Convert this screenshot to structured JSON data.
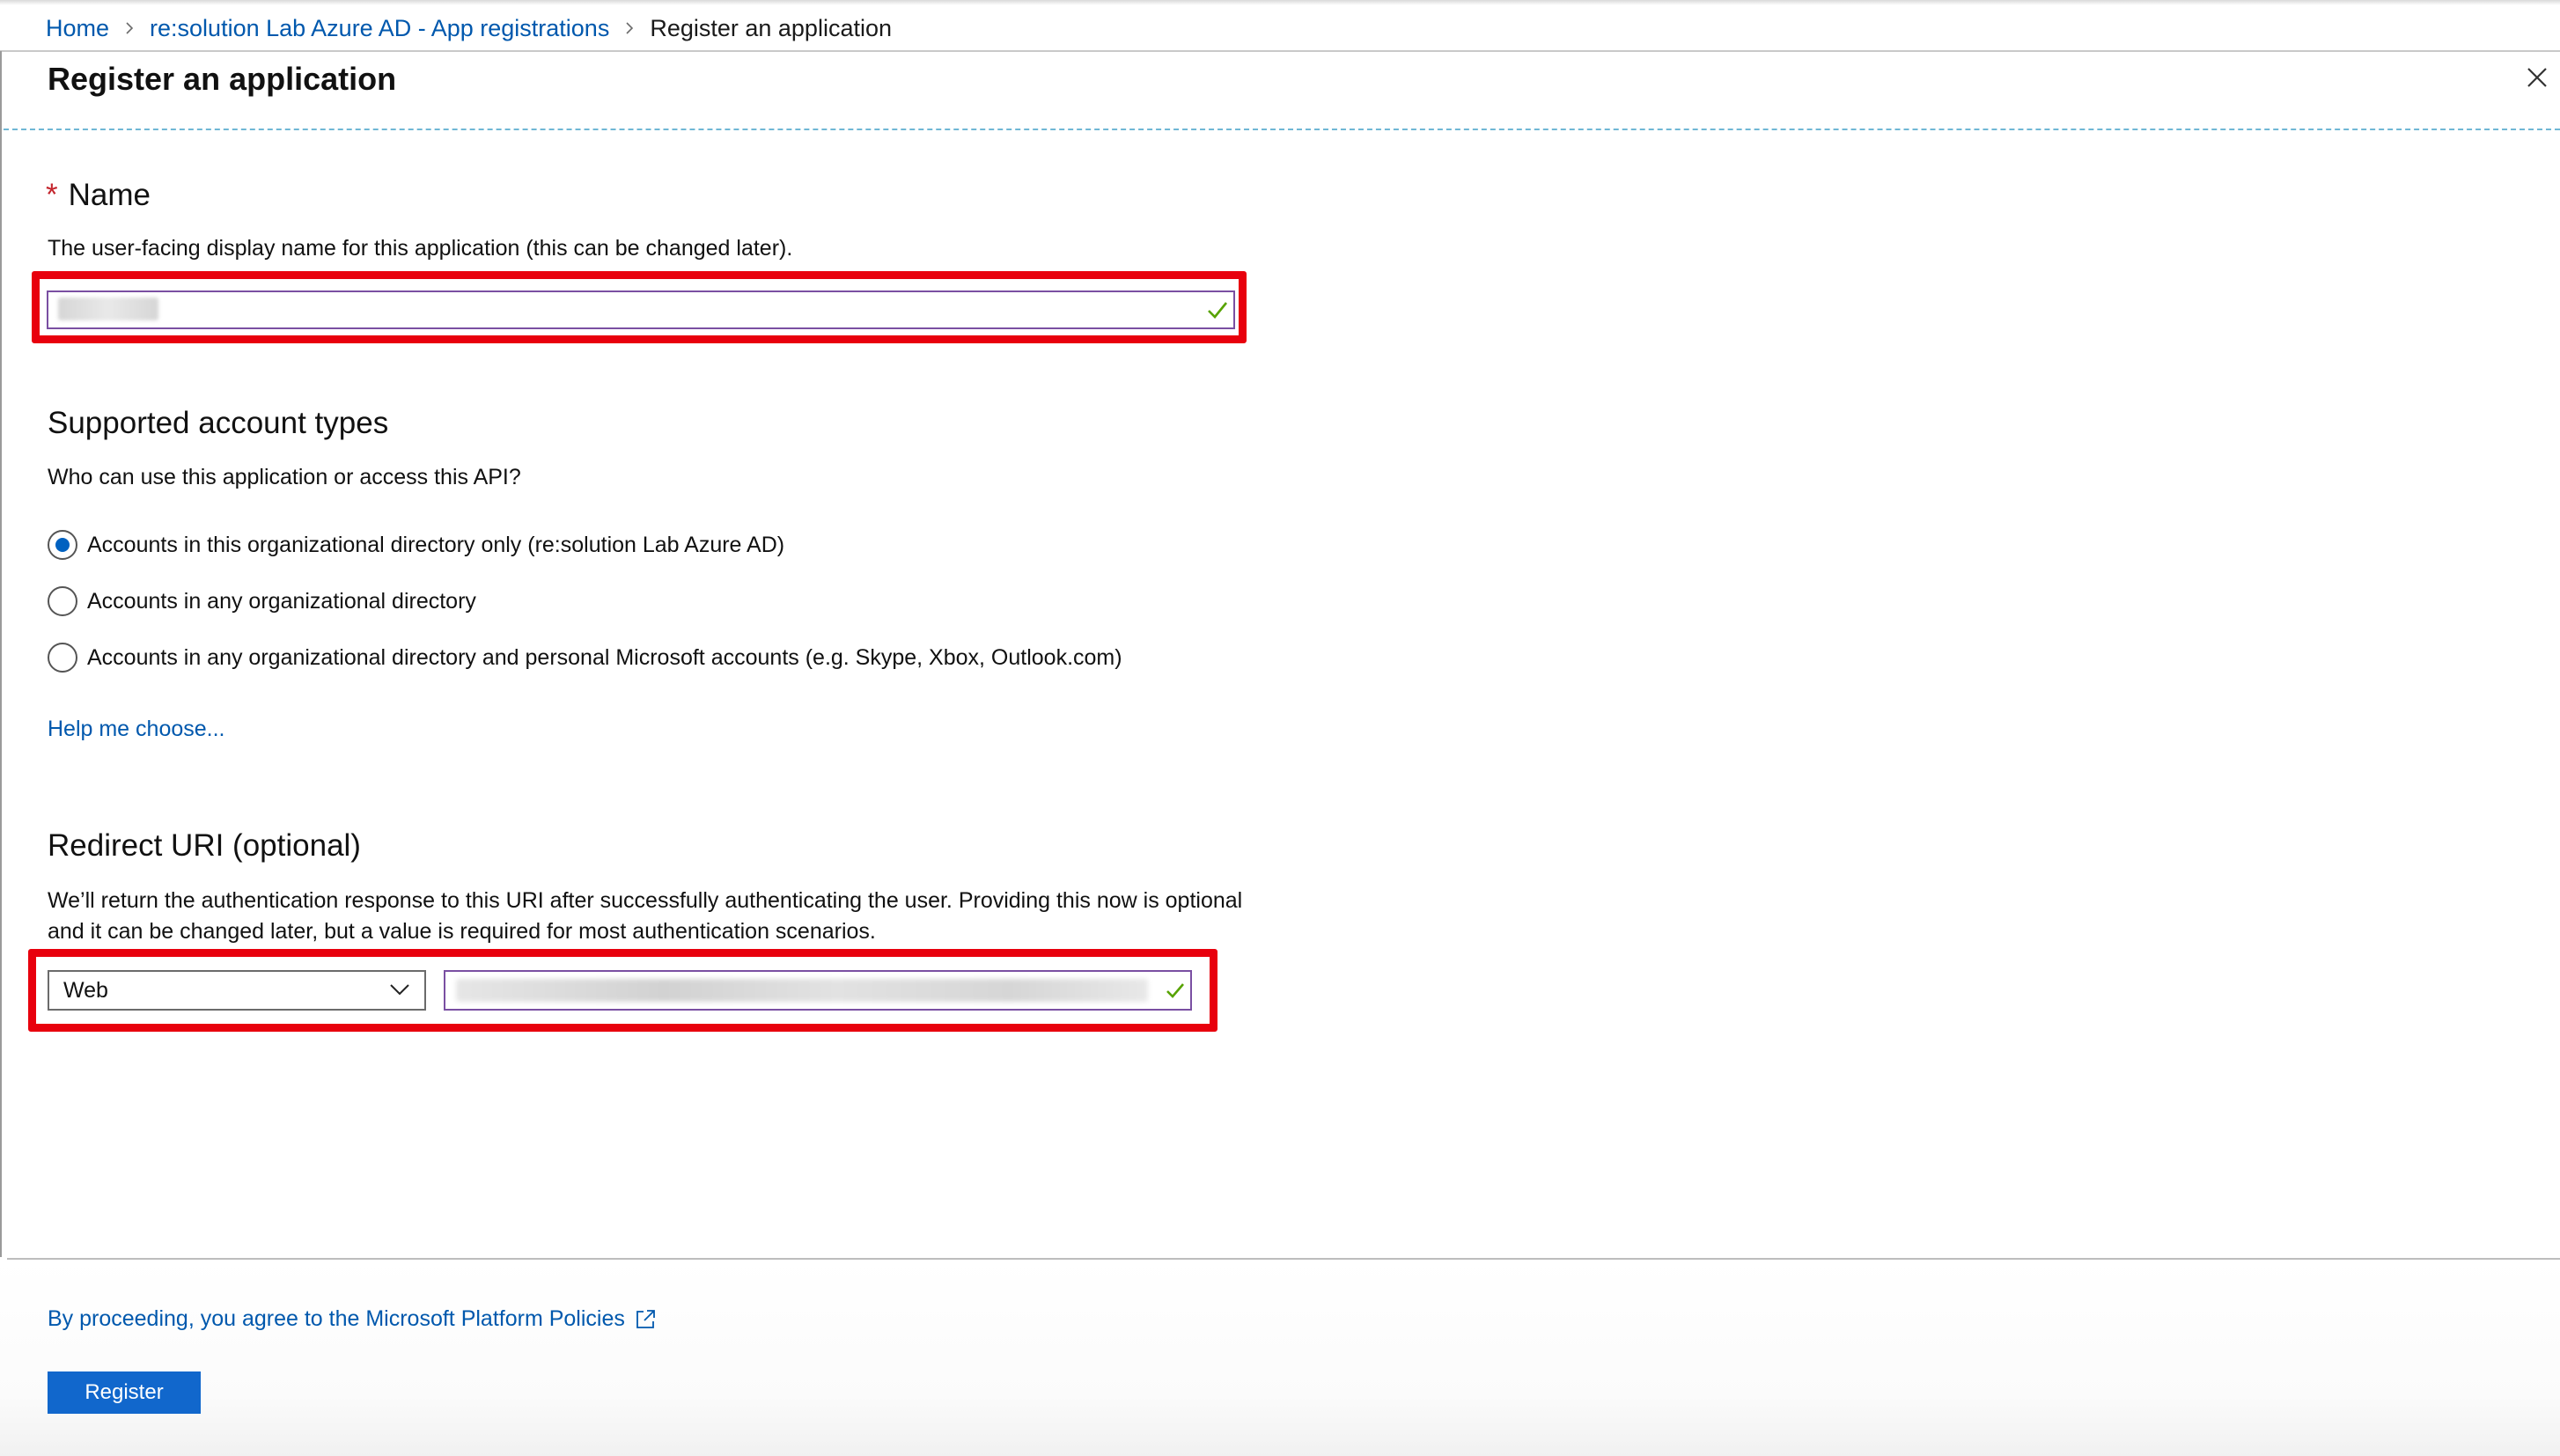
{
  "breadcrumb": {
    "items": [
      {
        "label": "Home"
      },
      {
        "label": "re:solution Lab Azure AD - App registrations"
      },
      {
        "label": "Register an application"
      }
    ]
  },
  "blade": {
    "title": "Register an application",
    "close_icon": "close-icon"
  },
  "name_section": {
    "required_marker": "*",
    "heading": "Name",
    "description": "The user-facing display name for this application (this can be changed later).",
    "input_value": "",
    "valid_icon": "checkmark-icon"
  },
  "account_types": {
    "heading": "Supported account types",
    "question": "Who can use this application or access this API?",
    "options": [
      {
        "label": "Accounts in this organizational directory only (re:solution Lab Azure AD)",
        "selected": true
      },
      {
        "label": "Accounts in any organizational directory",
        "selected": false
      },
      {
        "label": "Accounts in any organizational directory and personal Microsoft accounts (e.g. Skype, Xbox, Outlook.com)",
        "selected": false
      }
    ],
    "help_link": "Help me choose..."
  },
  "redirect_uri": {
    "heading": "Redirect URI (optional)",
    "description": "We’ll return the authentication response to this URI after successfully authenticating the user. Providing this now is optional and it can be changed later, but a value is required for most authentication scenarios.",
    "platform_value": "Web",
    "uri_value": "",
    "valid_icon": "checkmark-icon"
  },
  "footer": {
    "policies_link": "By proceeding, you agree to the Microsoft Platform Policies",
    "external_icon": "external-link-icon",
    "register_label": "Register"
  },
  "colors": {
    "link": "#0058ad",
    "highlight": "#e8000d",
    "primary_button": "#1167cc",
    "valid_check": "#57a300",
    "required": "#c4262e"
  }
}
